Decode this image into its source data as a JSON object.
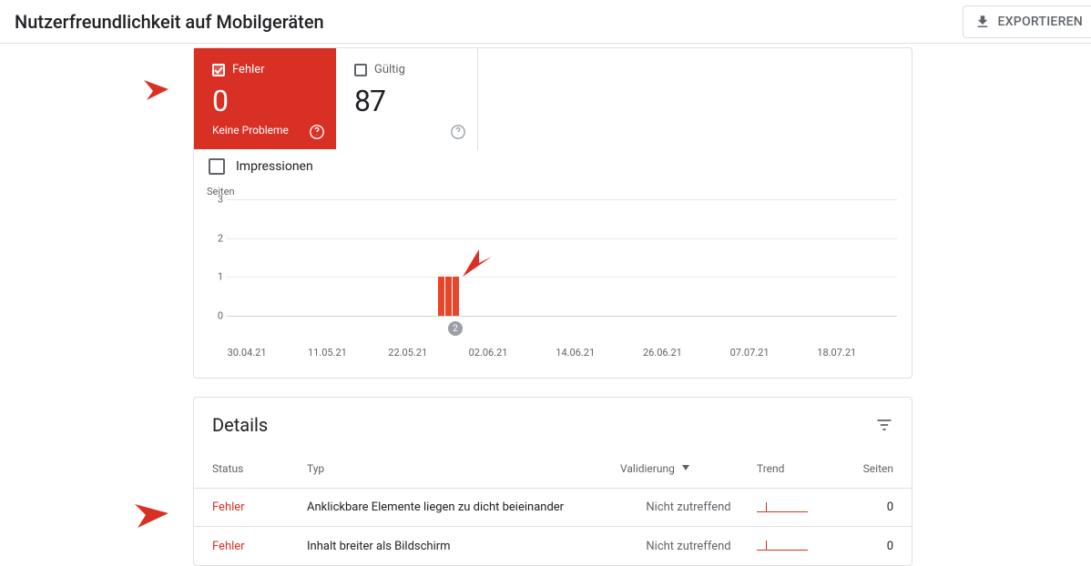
{
  "header": {
    "title": "Nutzerfreundlichkeit auf Mobilgeräten",
    "export": "EXPORTIEREN"
  },
  "tabs": {
    "errors": {
      "label": "Fehler",
      "value": "0",
      "sub": "Keine Probleme"
    },
    "valid": {
      "label": "Gültig",
      "value": "87"
    }
  },
  "impressions": {
    "label": "Impressionen"
  },
  "chart_data": {
    "type": "bar",
    "y_title": "Seiten",
    "y_ticks": [
      "3",
      "2",
      "1",
      "0"
    ],
    "ylim": [
      0,
      3
    ],
    "x_labels": [
      "30.04.21",
      "11.05.21",
      "22.05.21",
      "02.06.21",
      "14.06.21",
      "26.06.21",
      "07.07.21",
      "18.07.21"
    ],
    "series": [
      {
        "name": "Fehler",
        "values": [
          1,
          1,
          1
        ],
        "color": "#e8462a",
        "position_index": 2.6
      }
    ],
    "badge": "2"
  },
  "details": {
    "title": "Details",
    "columns": {
      "status": "Status",
      "typ": "Typ",
      "validierung": "Validierung",
      "trend": "Trend",
      "seiten": "Seiten"
    },
    "rows": [
      {
        "status": "Fehler",
        "typ": "Anklickbare Elemente liegen zu dicht beieinander",
        "validierung": "Nicht zutreffend",
        "seiten": "0"
      },
      {
        "status": "Fehler",
        "typ": "Inhalt breiter als Bildschirm",
        "validierung": "Nicht zutreffend",
        "seiten": "0"
      }
    ]
  }
}
